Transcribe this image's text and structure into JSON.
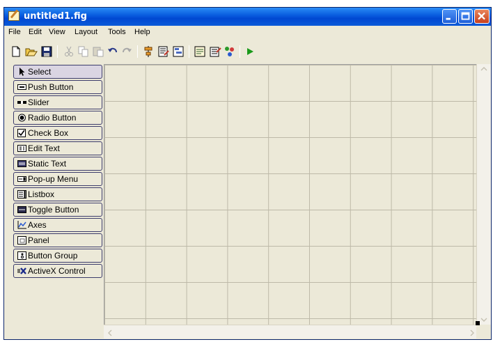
{
  "window": {
    "title": "untitled1.fig"
  },
  "menubar": {
    "items": [
      {
        "label": "File"
      },
      {
        "label": "Edit"
      },
      {
        "label": "View"
      },
      {
        "label": "Layout"
      },
      {
        "label": "Tools"
      },
      {
        "label": "Help"
      }
    ]
  },
  "toolbar": {
    "icons": [
      "new-icon",
      "open-icon",
      "save-icon",
      "cut-icon",
      "copy-icon",
      "paste-icon",
      "undo-icon",
      "redo-icon",
      "align-icon",
      "menu-editor-icon",
      "tab-order-icon",
      "mfile-editor-icon",
      "property-inspector-icon",
      "object-browser-icon",
      "run-icon"
    ]
  },
  "palette": {
    "items": [
      {
        "label": "Select",
        "icon": "arrow-icon"
      },
      {
        "label": "Push Button",
        "icon": "push-button-icon"
      },
      {
        "label": "Slider",
        "icon": "slider-icon"
      },
      {
        "label": "Radio Button",
        "icon": "radio-button-icon"
      },
      {
        "label": "Check Box",
        "icon": "check-box-icon"
      },
      {
        "label": "Edit Text",
        "icon": "edit-text-icon"
      },
      {
        "label": "Static Text",
        "icon": "static-text-icon"
      },
      {
        "label": "Pop-up Menu",
        "icon": "popup-menu-icon"
      },
      {
        "label": "Listbox",
        "icon": "listbox-icon"
      },
      {
        "label": "Toggle Button",
        "icon": "toggle-button-icon"
      },
      {
        "label": "Axes",
        "icon": "axes-icon"
      },
      {
        "label": "Panel",
        "icon": "panel-icon"
      },
      {
        "label": "Button Group",
        "icon": "button-group-icon"
      },
      {
        "label": "ActiveX Control",
        "icon": "activex-icon"
      }
    ]
  },
  "colors": {
    "titlebar": "#0A5FE0",
    "window_bg": "#ECE9D8",
    "grid": "#BDB9A8",
    "run": "#1A9A1A"
  }
}
